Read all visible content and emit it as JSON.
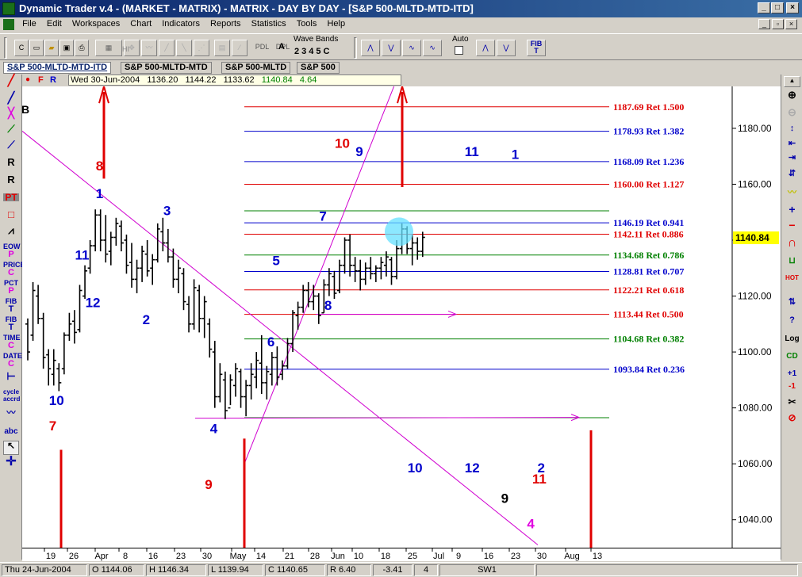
{
  "window": {
    "title": "Dynamic Trader v.4 - (MARKET - MATRIX) - MATRIX - DAY BY DAY - [S&P 500-MLTD-MTD-ITD]"
  },
  "menu": [
    "File",
    "Edit",
    "Workspaces",
    "Chart",
    "Indicators",
    "Reports",
    "Statistics",
    "Tools",
    "Help"
  ],
  "toolbar": {
    "pdl": "PDL",
    "dpl": "DPL",
    "hi": "HI",
    "wave_bands_label": "Wave Bands",
    "wave_bands_nums": "2345C",
    "a_label": "A",
    "auto_label": "Auto",
    "fib_label": "FIB",
    "t_label": "T"
  },
  "tabs": [
    "S&P 500-MLTD-MTD-ITD",
    "S&P 500-MLTD-MTD",
    "S&P 500-MLTD",
    "S&P 500"
  ],
  "info": {
    "f": "F",
    "r": "R",
    "date": "Wed 30-Jun-2004",
    "open": "1136.20",
    "high": "1144.22",
    "low": "1133.62",
    "close": "1140.84",
    "change": "4.64"
  },
  "left_tools": [
    "EOW",
    "P",
    "PRICE",
    "C",
    "PCT",
    "P",
    "FIB",
    "T",
    "FIB",
    "T",
    "TIME",
    "C",
    "DATE",
    "C",
    "cycle",
    "accrd",
    "abc"
  ],
  "right_tools": [
    "Log",
    "CD",
    "+1",
    "-1",
    "HOT"
  ],
  "chart_data": {
    "type": "bar",
    "price_axis": {
      "ylim": [
        1030,
        1195
      ],
      "ticks": [
        "1040.00",
        "1060.00",
        "1080.00",
        "1100.00",
        "1120.00",
        "1140.00",
        "1160.00",
        "1180.00"
      ],
      "current": "1140.84"
    },
    "date_axis": {
      "ticks": [
        "19",
        "26",
        "Apr",
        "8",
        "16",
        "23",
        "30",
        "May",
        "14",
        "21",
        "28",
        "Jun",
        "10",
        "18",
        "25",
        "Jul",
        "9",
        "16",
        "23",
        "30",
        "Aug",
        "13"
      ]
    },
    "fib_levels": [
      {
        "label": "1187.69 Ret 1.500",
        "value": 1187.69,
        "color": "#e00000"
      },
      {
        "label": "1178.93 Ret 1.382",
        "value": 1178.93,
        "color": "#0000cc"
      },
      {
        "label": "1168.09 Ret 1.236",
        "value": 1168.09,
        "color": "#0000cc"
      },
      {
        "label": "1160.00 Ret 1.127",
        "value": 1160.0,
        "color": "#e00000"
      },
      {
        "label": "",
        "value": 1150.5,
        "color": "#008000"
      },
      {
        "label": "1146.19 Ret 0.941",
        "value": 1146.19,
        "color": "#0000cc"
      },
      {
        "label": "1142.11 Ret 0.886",
        "value": 1142.11,
        "color": "#e00000"
      },
      {
        "label": "1134.68 Ret 0.786",
        "value": 1134.68,
        "color": "#008000"
      },
      {
        "label": "1128.81 Ret 0.707",
        "value": 1128.81,
        "color": "#0000cc"
      },
      {
        "label": "1122.21 Ret 0.618",
        "value": 1122.21,
        "color": "#e00000"
      },
      {
        "label": "1113.44 Ret 0.500",
        "value": 1113.44,
        "color": "#e00000"
      },
      {
        "label": "1104.68 Ret 0.382",
        "value": 1104.68,
        "color": "#008000"
      },
      {
        "label": "1093.84 Ret 0.236",
        "value": 1093.84,
        "color": "#0000cc"
      },
      {
        "label": "",
        "value": 1076.5,
        "color": "#008000"
      }
    ],
    "bars": [
      {
        "d": 0,
        "h": 1112,
        "l": 1097,
        "o": 1110,
        "c": 1100
      },
      {
        "d": 1,
        "h": 1125,
        "l": 1104,
        "o": 1106,
        "c": 1122
      },
      {
        "d": 2,
        "h": 1124,
        "l": 1110,
        "o": 1120,
        "c": 1112
      },
      {
        "d": 3,
        "h": 1114,
        "l": 1094,
        "o": 1112,
        "c": 1098
      },
      {
        "d": 4,
        "h": 1101,
        "l": 1088,
        "o": 1099,
        "c": 1094
      },
      {
        "d": 5,
        "h": 1101,
        "l": 1088,
        "o": 1092,
        "c": 1097
      },
      {
        "d": 6,
        "h": 1096,
        "l": 1086,
        "o": 1094,
        "c": 1089
      },
      {
        "d": 7,
        "h": 1107,
        "l": 1092,
        "o": 1094,
        "c": 1106
      },
      {
        "d": 8,
        "h": 1114,
        "l": 1104,
        "o": 1106,
        "c": 1110
      },
      {
        "d": 9,
        "h": 1115,
        "l": 1103,
        "o": 1111,
        "c": 1107
      },
      {
        "d": 10,
        "h": 1124,
        "l": 1107,
        "o": 1108,
        "c": 1122
      },
      {
        "d": 11,
        "h": 1131,
        "l": 1119,
        "o": 1120,
        "c": 1129
      },
      {
        "d": 12,
        "h": 1140,
        "l": 1128,
        "o": 1130,
        "c": 1138
      },
      {
        "d": 13,
        "h": 1151,
        "l": 1136,
        "o": 1138,
        "c": 1149
      },
      {
        "d": 14,
        "h": 1151,
        "l": 1136,
        "o": 1149,
        "c": 1140
      },
      {
        "d": 15,
        "h": 1149,
        "l": 1132,
        "o": 1140,
        "c": 1135
      },
      {
        "d": 16,
        "h": 1143,
        "l": 1131,
        "o": 1136,
        "c": 1141
      },
      {
        "d": 17,
        "h": 1148,
        "l": 1138,
        "o": 1141,
        "c": 1146
      },
      {
        "d": 18,
        "h": 1147,
        "l": 1136,
        "o": 1145,
        "c": 1139
      },
      {
        "d": 19,
        "h": 1142,
        "l": 1128,
        "o": 1140,
        "c": 1131
      },
      {
        "d": 20,
        "h": 1139,
        "l": 1123,
        "o": 1132,
        "c": 1126
      },
      {
        "d": 21,
        "h": 1133,
        "l": 1121,
        "o": 1126,
        "c": 1130
      },
      {
        "d": 22,
        "h": 1138,
        "l": 1125,
        "o": 1130,
        "c": 1136
      },
      {
        "d": 23,
        "h": 1140,
        "l": 1127,
        "o": 1135,
        "c": 1129
      },
      {
        "d": 24,
        "h": 1135,
        "l": 1124,
        "o": 1130,
        "c": 1133
      },
      {
        "d": 25,
        "h": 1146,
        "l": 1132,
        "o": 1133,
        "c": 1144
      },
      {
        "d": 26,
        "h": 1148,
        "l": 1136,
        "o": 1143,
        "c": 1139
      },
      {
        "d": 27,
        "h": 1144,
        "l": 1132,
        "o": 1139,
        "c": 1134
      },
      {
        "d": 28,
        "h": 1137,
        "l": 1123,
        "o": 1134,
        "c": 1126
      },
      {
        "d": 29,
        "h": 1133,
        "l": 1121,
        "o": 1126,
        "c": 1130
      },
      {
        "d": 30,
        "h": 1130,
        "l": 1115,
        "o": 1128,
        "c": 1118
      },
      {
        "d": 31,
        "h": 1120,
        "l": 1107,
        "o": 1117,
        "c": 1110
      },
      {
        "d": 32,
        "h": 1126,
        "l": 1108,
        "o": 1110,
        "c": 1123
      },
      {
        "d": 33,
        "h": 1124,
        "l": 1107,
        "o": 1122,
        "c": 1112
      },
      {
        "d": 34,
        "h": 1120,
        "l": 1105,
        "o": 1112,
        "c": 1118
      },
      {
        "d": 35,
        "h": 1112,
        "l": 1098,
        "o": 1110,
        "c": 1101
      },
      {
        "d": 36,
        "h": 1104,
        "l": 1080,
        "o": 1100,
        "c": 1084
      },
      {
        "d": 37,
        "h": 1096,
        "l": 1082,
        "o": 1084,
        "c": 1092
      },
      {
        "d": 38,
        "h": 1093,
        "l": 1076,
        "o": 1090,
        "c": 1079
      },
      {
        "d": 39,
        "h": 1092,
        "l": 1081,
        "o": 1080,
        "c": 1090
      },
      {
        "d": 40,
        "h": 1096,
        "l": 1084,
        "o": 1088,
        "c": 1094
      },
      {
        "d": 41,
        "h": 1094,
        "l": 1080,
        "o": 1093,
        "c": 1084
      },
      {
        "d": 42,
        "h": 1090,
        "l": 1077,
        "o": 1084,
        "c": 1088
      },
      {
        "d": 43,
        "h": 1096,
        "l": 1083,
        "o": 1088,
        "c": 1092
      },
      {
        "d": 44,
        "h": 1100,
        "l": 1087,
        "o": 1091,
        "c": 1097
      },
      {
        "d": 45,
        "h": 1106,
        "l": 1085,
        "o": 1096,
        "c": 1089
      },
      {
        "d": 46,
        "h": 1095,
        "l": 1083,
        "o": 1089,
        "c": 1093
      },
      {
        "d": 47,
        "h": 1100,
        "l": 1088,
        "o": 1092,
        "c": 1098
      },
      {
        "d": 48,
        "h": 1102,
        "l": 1088,
        "o": 1098,
        "c": 1091
      },
      {
        "d": 49,
        "h": 1097,
        "l": 1090,
        "o": 1092,
        "c": 1095
      },
      {
        "d": 50,
        "h": 1105,
        "l": 1094,
        "o": 1095,
        "c": 1103
      },
      {
        "d": 51,
        "h": 1115,
        "l": 1100,
        "o": 1103,
        "c": 1114
      },
      {
        "d": 52,
        "h": 1118,
        "l": 1108,
        "o": 1113,
        "c": 1116
      },
      {
        "d": 53,
        "h": 1124,
        "l": 1114,
        "o": 1116,
        "c": 1122
      },
      {
        "d": 54,
        "h": 1125,
        "l": 1116,
        "o": 1122,
        "c": 1118
      },
      {
        "d": 55,
        "h": 1124,
        "l": 1115,
        "o": 1118,
        "c": 1120
      },
      {
        "d": 56,
        "h": 1121,
        "l": 1110,
        "o": 1120,
        "c": 1113
      },
      {
        "d": 57,
        "h": 1126,
        "l": 1114,
        "o": 1114,
        "c": 1124
      },
      {
        "d": 58,
        "h": 1130,
        "l": 1120,
        "o": 1124,
        "c": 1128
      },
      {
        "d": 59,
        "h": 1129,
        "l": 1119,
        "o": 1127,
        "c": 1121
      },
      {
        "d": 60,
        "h": 1133,
        "l": 1121,
        "o": 1122,
        "c": 1131
      },
      {
        "d": 61,
        "h": 1141,
        "l": 1128,
        "o": 1131,
        "c": 1140
      },
      {
        "d": 62,
        "h": 1142,
        "l": 1127,
        "o": 1140,
        "c": 1131
      },
      {
        "d": 63,
        "h": 1134,
        "l": 1125,
        "o": 1131,
        "c": 1129
      },
      {
        "d": 64,
        "h": 1133,
        "l": 1122,
        "o": 1129,
        "c": 1126
      },
      {
        "d": 65,
        "h": 1132,
        "l": 1124,
        "o": 1126,
        "c": 1130
      },
      {
        "d": 66,
        "h": 1134,
        "l": 1126,
        "o": 1130,
        "c": 1128
      },
      {
        "d": 67,
        "h": 1131,
        "l": 1125,
        "o": 1128,
        "c": 1130
      },
      {
        "d": 68,
        "h": 1134,
        "l": 1126,
        "o": 1130,
        "c": 1132
      },
      {
        "d": 69,
        "h": 1136,
        "l": 1127,
        "o": 1131,
        "c": 1134
      },
      {
        "d": 70,
        "h": 1134,
        "l": 1124,
        "o": 1133,
        "c": 1127
      },
      {
        "d": 71,
        "h": 1140,
        "l": 1126,
        "o": 1127,
        "c": 1137
      },
      {
        "d": 72,
        "h": 1146,
        "l": 1135,
        "o": 1137,
        "c": 1144
      },
      {
        "d": 73,
        "h": 1145,
        "l": 1135,
        "o": 1144,
        "c": 1137
      },
      {
        "d": 74,
        "h": 1142,
        "l": 1131,
        "o": 1137,
        "c": 1139
      },
      {
        "d": 75,
        "h": 1141,
        "l": 1133,
        "o": 1139,
        "c": 1136
      },
      {
        "d": 76,
        "h": 1143,
        "l": 1134,
        "o": 1136,
        "c": 1141
      }
    ],
    "wave_labels": [
      {
        "t": "1",
        "d": 14,
        "p": 1155,
        "color": "#0000cc"
      },
      {
        "t": "3",
        "d": 27,
        "p": 1149,
        "color": "#0000cc"
      },
      {
        "t": "11",
        "d": 10,
        "p": 1133,
        "color": "#0000cc"
      },
      {
        "t": "12",
        "d": 12,
        "p": 1116,
        "color": "#0000cc"
      },
      {
        "t": "2",
        "d": 23,
        "p": 1110,
        "color": "#0000cc"
      },
      {
        "t": "10",
        "d": 5,
        "p": 1081,
        "color": "#0000cc"
      },
      {
        "t": "7",
        "d": 5,
        "p": 1072,
        "color": "#e00000"
      },
      {
        "t": "8",
        "d": 14,
        "p": 1165,
        "color": "#e00000"
      },
      {
        "t": "4",
        "d": 36,
        "p": 1071,
        "color": "#0000cc"
      },
      {
        "t": "9",
        "d": 35,
        "p": 1051,
        "color": "#e00000"
      },
      {
        "t": "5",
        "d": 48,
        "p": 1131,
        "color": "#0000cc"
      },
      {
        "t": "6",
        "d": 47,
        "p": 1102,
        "color": "#0000cc"
      },
      {
        "t": "7",
        "d": 57,
        "p": 1147,
        "color": "#0000cc"
      },
      {
        "t": "8",
        "d": 58,
        "p": 1115,
        "color": "#0000cc"
      },
      {
        "t": "10",
        "d": 60,
        "p": 1173,
        "color": "#e00000"
      },
      {
        "t": "9",
        "d": 64,
        "p": 1170,
        "color": "#0000cc"
      },
      {
        "t": "11",
        "d": 85,
        "p": 1170,
        "color": "#0000cc"
      },
      {
        "t": "1",
        "d": 94,
        "p": 1169,
        "color": "#0000cc"
      },
      {
        "t": "10",
        "d": 74,
        "p": 1057,
        "color": "#0000cc"
      },
      {
        "t": "12",
        "d": 85,
        "p": 1057,
        "color": "#0000cc"
      },
      {
        "t": "9",
        "d": 92,
        "p": 1046,
        "color": "#000000"
      },
      {
        "t": "11",
        "d": 98,
        "p": 1053,
        "color": "#e00000"
      },
      {
        "t": "2",
        "d": 99,
        "p": 1057,
        "color": "#0000cc"
      },
      {
        "t": "4",
        "d": 97,
        "p": 1037,
        "color": "#e000e0"
      }
    ]
  },
  "status": {
    "date": "Thu 24-Jun-2004",
    "open": "O 1144.06",
    "high": "H 1146.34",
    "low": "L 1139.94",
    "close": "C 1140.65",
    "range": "R 6.40",
    "change": "-3.41",
    "num": "4",
    "sw": "SW1"
  }
}
